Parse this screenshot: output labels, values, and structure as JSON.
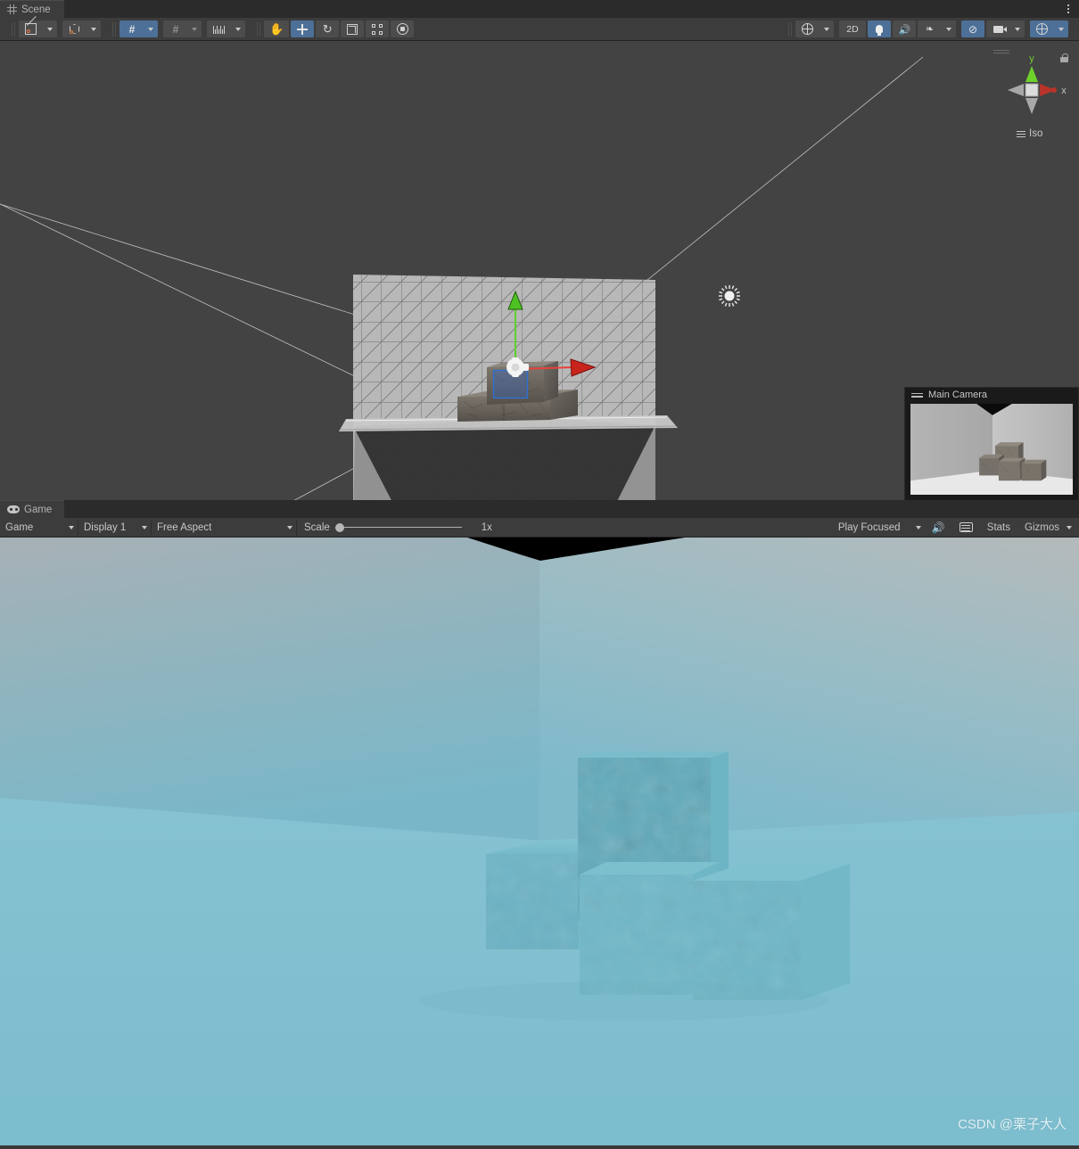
{
  "scene_panel": {
    "tab": {
      "label": "Scene",
      "icon": "grid-icon"
    },
    "overflow_icon": "kebab-menu-icon",
    "toolbar": {
      "left_groups": [
        {
          "name": "draw-mode",
          "label": "",
          "icon": "shaded-wireframe-icon",
          "has_dropdown": true,
          "active": false
        },
        {
          "name": "render-mode",
          "label": "",
          "icon": "cube-shading-icon",
          "has_dropdown": true,
          "active": false
        },
        {
          "name": "grid-snap",
          "label": "",
          "icon": "grid-axis-y-icon",
          "has_dropdown": true,
          "active": true
        },
        {
          "name": "surface-snap",
          "label": "",
          "icon": "vertex-snap-icon",
          "has_dropdown": true,
          "active": false
        },
        {
          "name": "grid-size",
          "label": "",
          "icon": "ruler-icon",
          "has_dropdown": true,
          "active": false
        }
      ],
      "transform_tools": [
        {
          "name": "hand-tool",
          "icon": "hand-icon",
          "active": false
        },
        {
          "name": "move-tool",
          "icon": "move-arrows-icon",
          "active": true
        },
        {
          "name": "rotate-tool",
          "icon": "rotate-icon",
          "active": false
        },
        {
          "name": "scale-tool",
          "icon": "scale-icon",
          "active": false
        },
        {
          "name": "rect-tool",
          "icon": "rect-transform-icon",
          "active": false
        },
        {
          "name": "transform-tool",
          "icon": "transform-icon",
          "active": false
        }
      ],
      "right_items": [
        {
          "name": "view-options",
          "label": "",
          "icon": "globe-icon",
          "has_dropdown": true,
          "active": false
        },
        {
          "name": "toggle-2d",
          "label": "2D",
          "icon": "",
          "has_dropdown": false,
          "active": false
        },
        {
          "name": "toggle-lighting",
          "label": "",
          "icon": "lightbulb-icon",
          "has_dropdown": false,
          "active": true
        },
        {
          "name": "toggle-audio",
          "label": "",
          "icon": "audio-muted-icon",
          "has_dropdown": false,
          "active": false
        },
        {
          "name": "toggle-effects",
          "label": "",
          "icon": "fx-icon",
          "has_dropdown": true,
          "active": false
        },
        {
          "name": "toggle-hidden-objects",
          "label": "",
          "icon": "eye-off-icon",
          "has_dropdown": false,
          "active": true
        },
        {
          "name": "camera-settings",
          "label": "",
          "icon": "camera-icon",
          "has_dropdown": true,
          "active": false
        },
        {
          "name": "scene-visibility-gizmos",
          "label": "",
          "icon": "gizmo-globe-icon",
          "has_dropdown": true,
          "active": true
        }
      ]
    },
    "nav_gizmo": {
      "axis_x_label": "x",
      "axis_y_label": "y",
      "projection_label": "Iso",
      "lock_icon": "lock-icon",
      "color_x": "#b8342a",
      "color_y": "#62c425",
      "color_z": "#9a9a9a"
    },
    "camera_preview": {
      "title": "Main Camera",
      "icon": "camera-preview-handle-icon"
    },
    "gizmos": {
      "directional_light_icon": "sun-icon",
      "move_handle_x_color": "#e8413a",
      "move_handle_y_color": "#5cd02a",
      "selection_outline_color": "#2f6fd0"
    }
  },
  "game_panel": {
    "tab": {
      "label": "Game",
      "icon": "gamepad-icon"
    },
    "overflow_icon": "kebab-menu-icon",
    "toolbar": {
      "view_mode": "Game",
      "display": "Display 1",
      "aspect": "Free Aspect",
      "scale_label": "Scale",
      "scale_value": "1x",
      "scale_position_pct": 0,
      "play_mode_focus": "Play Focused",
      "mute_audio_icon": "speaker-icon",
      "stats_toggle_icon": "keyboard-icon",
      "stats_label": "Stats",
      "gizmos_label": "Gizmos"
    },
    "render": {
      "sky_top_color": "#a9b3b8",
      "sky_bottom_color": "#76b5c6",
      "floor_color": "#7ebfd0",
      "wall_left_color": "#9fb0b8",
      "wall_right_color": "#b2b7b9",
      "ceiling_color": "#000000",
      "cube_color": "#63aec0",
      "cube_count": 4
    },
    "watermark": "CSDN @栗子大人"
  }
}
